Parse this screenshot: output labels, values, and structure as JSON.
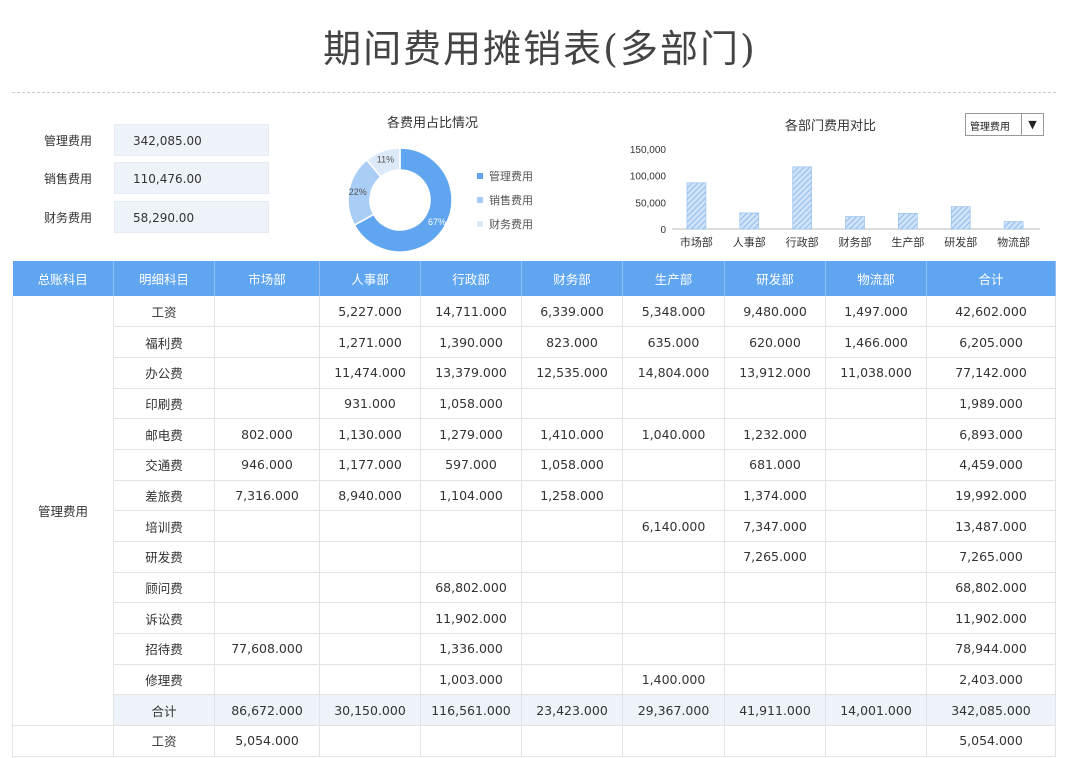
{
  "title": "期间费用摊销表(多部门)",
  "summary": [
    {
      "label": "管理费用",
      "value": "342,085.00"
    },
    {
      "label": "销售费用",
      "value": "110,476.00"
    },
    {
      "label": "财务费用",
      "value": "58,290.00"
    }
  ],
  "donut": {
    "title": "各费用占比情况",
    "slices": [
      {
        "name": "管理费用",
        "percent": 67,
        "label": "67%",
        "color": "#5fa5f0"
      },
      {
        "name": "销售费用",
        "percent": 22,
        "label": "22%",
        "color": "#a9cdf5"
      },
      {
        "name": "财务费用",
        "percent": 11,
        "label": "11%",
        "color": "#dbe9f8"
      }
    ]
  },
  "bar_chart": {
    "title": "各部门费用对比",
    "selected": "管理费用",
    "arrow": "▼",
    "color": "#8fbcec"
  },
  "chart_data": {
    "type": "bar",
    "title": "各部门费用对比",
    "categories": [
      "市场部",
      "人事部",
      "行政部",
      "财务部",
      "生产部",
      "研发部",
      "物流部"
    ],
    "values": [
      86672,
      30150,
      116561,
      23423,
      29367,
      41911,
      14001
    ],
    "ylim": [
      0,
      150000
    ],
    "yticks": [
      "0",
      "50,000",
      "100,000",
      "150,000"
    ],
    "ytick_values": [
      0,
      50000,
      100000,
      150000
    ],
    "grid": false
  },
  "table": {
    "headers": [
      "总账科目",
      "明细科目",
      "市场部",
      "人事部",
      "行政部",
      "财务部",
      "生产部",
      "研发部",
      "物流部",
      "合计"
    ],
    "group_label": "管理费用",
    "rows": [
      [
        "工资",
        "",
        "5,227.000",
        "14,711.000",
        "6,339.000",
        "5,348.000",
        "9,480.000",
        "1,497.000",
        "42,602.000"
      ],
      [
        "福利费",
        "",
        "1,271.000",
        "1,390.000",
        "823.000",
        "635.000",
        "620.000",
        "1,466.000",
        "6,205.000"
      ],
      [
        "办公费",
        "",
        "11,474.000",
        "13,379.000",
        "12,535.000",
        "14,804.000",
        "13,912.000",
        "11,038.000",
        "77,142.000"
      ],
      [
        "印刷费",
        "",
        "931.000",
        "1,058.000",
        "",
        "",
        "",
        "",
        "1,989.000"
      ],
      [
        "邮电费",
        "802.000",
        "1,130.000",
        "1,279.000",
        "1,410.000",
        "1,040.000",
        "1,232.000",
        "",
        "6,893.000"
      ],
      [
        "交通费",
        "946.000",
        "1,177.000",
        "597.000",
        "1,058.000",
        "",
        "681.000",
        "",
        "4,459.000"
      ],
      [
        "差旅费",
        "7,316.000",
        "8,940.000",
        "1,104.000",
        "1,258.000",
        "",
        "1,374.000",
        "",
        "19,992.000"
      ],
      [
        "培训费",
        "",
        "",
        "",
        "",
        "6,140.000",
        "7,347.000",
        "",
        "13,487.000"
      ],
      [
        "研发费",
        "",
        "",
        "",
        "",
        "",
        "7,265.000",
        "",
        "7,265.000"
      ],
      [
        "顾问费",
        "",
        "",
        "68,802.000",
        "",
        "",
        "",
        "",
        "68,802.000"
      ],
      [
        "诉讼费",
        "",
        "",
        "11,902.000",
        "",
        "",
        "",
        "",
        "11,902.000"
      ],
      [
        "招待费",
        "77,608.000",
        "",
        "1,336.000",
        "",
        "",
        "",
        "",
        "78,944.000"
      ],
      [
        "修理费",
        "",
        "",
        "1,003.000",
        "",
        "1,400.000",
        "",
        "",
        "2,403.000"
      ]
    ],
    "subtotal": [
      "合计",
      "86,672.000",
      "30,150.000",
      "116,561.000",
      "23,423.000",
      "29,367.000",
      "41,911.000",
      "14,001.000",
      "342,085.000"
    ],
    "next_group_rows": [
      [
        "工资",
        "5,054.000",
        "",
        "",
        "",
        "",
        "",
        "",
        "5,054.000"
      ]
    ]
  }
}
